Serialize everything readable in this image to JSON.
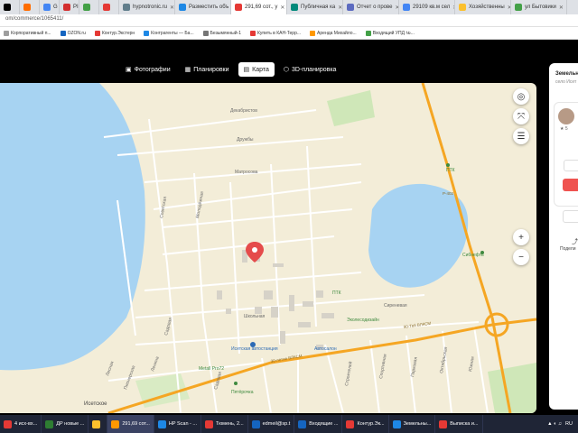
{
  "browser": {
    "tabs": [
      {
        "label": "",
        "color": "#000000",
        "active": false
      },
      {
        "label": "",
        "color": "#ff6d00",
        "active": false
      },
      {
        "label": "G",
        "color": "#4285f4",
        "active": false
      },
      {
        "label": "PIC",
        "color": "#d32f2f",
        "active": false
      },
      {
        "label": "",
        "color": "#43a047",
        "active": false
      },
      {
        "label": "",
        "color": "#e53935",
        "active": false
      },
      {
        "label": "hypnotronic.ru",
        "color": "#607d8b",
        "active": false
      },
      {
        "label": "Разместить объ",
        "color": "#1e88e5",
        "active": false
      },
      {
        "label": "291,69 сот., у",
        "color": "#e53935",
        "active": true
      },
      {
        "label": "Публичная ка",
        "color": "#00897b",
        "active": false
      },
      {
        "label": "Отчет о прове",
        "color": "#5c6bc0",
        "active": false
      },
      {
        "label": "29109 кв.м сел",
        "color": "#4285f4",
        "active": false
      },
      {
        "label": "Хозяйственны",
        "color": "#fbc02d",
        "active": false
      },
      {
        "label": "ул Бытовики",
        "color": "#43a047",
        "active": false
      }
    ],
    "url": "om/commerce/1065411/",
    "bookmarks": [
      {
        "label": "Корпоративный п...",
        "color": "#9e9e9e"
      },
      {
        "label": "OZON.ru",
        "color": "#1565c0"
      },
      {
        "label": "Контур.Экстерн",
        "color": "#e53935"
      },
      {
        "label": "Контрагенты — Ба...",
        "color": "#1e88e5"
      },
      {
        "label": "Безымянный-1",
        "color": "#757575"
      },
      {
        "label": "Купить в КАН-Терр...",
        "color": "#e53935"
      },
      {
        "label": "Аренда Михайло...",
        "color": "#ff9800"
      },
      {
        "label": "Входящий УПД №...",
        "color": "#43a047"
      }
    ]
  },
  "view_tabs": [
    {
      "label": "Фотографии",
      "icon": "photo-icon",
      "glyph": "▣",
      "active": false
    },
    {
      "label": "Планировки",
      "icon": "plan-icon",
      "glyph": "▦",
      "active": false
    },
    {
      "label": "Карта",
      "icon": "map-icon",
      "glyph": "▤",
      "active": true
    },
    {
      "label": "3D-планировка",
      "icon": "3d-icon",
      "glyph": "⬡",
      "active": false
    }
  ],
  "map": {
    "controls": {
      "locate": "◎",
      "fullscreen": "⤧",
      "layers": "☰",
      "zoom_in": "+",
      "zoom_out": "−"
    },
    "labels": {
      "dekabrist": "Декабристов",
      "druzhby": "Дружбы",
      "matrosova": "Матросова",
      "sovetskaya": "Советская",
      "molodezhnaya": "Молодёжная",
      "sirenevaya": "Сиреневая",
      "shkolnaya": "Школьная",
      "sadovaya": "Садовая",
      "r402_1": "Р-402",
      "r402_2": "90-Тей ВЛКСМ",
      "r402_3": "30-летие ВЛКСМ",
      "ozeritsy": "Озерияния",
      "ptk1": "ПТК",
      "ptk2": "ПТК",
      "sibneft": "Сибнефть",
      "isetskaya_avto": "Исетская автостанция",
      "avtosalon": "Автосалон",
      "ekoles": "Эколесодизайн",
      "metall": "Metall Pro72",
      "pyaterochka": "Пятёрочка",
      "iset": "Исетское",
      "lenina": "Ленина",
      "pionerskaya": "Пионерская",
      "lesnaya": "Лесная",
      "sportivnaya": "Спортивная",
      "sadovaya2": "Садовая",
      "parkovaya": "Парковая",
      "oktyabrskaya": "Октябрьская",
      "yuzhnaya": "Южная",
      "stroiteley": "Строителей"
    }
  },
  "side_panel": {
    "title": "Земельн",
    "subtitle": "село Исет",
    "rating": "★ 5",
    "share_icon": "share-icon",
    "share_label": "Подели"
  },
  "taskbar": {
    "items": [
      {
        "label": "4 исх-вх...",
        "color": "#e53935",
        "active": false
      },
      {
        "label": "ДР новые ...",
        "color": "#2e7d32",
        "active": false
      },
      {
        "label": "",
        "color": "#fbc02d",
        "active": false
      },
      {
        "label": "291,69 сот...",
        "color": "#ff9800",
        "active": true
      },
      {
        "label": "HP Scan - ...",
        "color": "#1e88e5",
        "active": false
      },
      {
        "label": "Тюмень, 2...",
        "color": "#e53935",
        "active": false
      },
      {
        "label": "edmeil@sp.t",
        "color": "#1565c0",
        "active": false
      },
      {
        "label": "Входящие ...",
        "color": "#1565c0",
        "active": false
      },
      {
        "label": "Контур.Эк...",
        "color": "#e53935",
        "active": false
      },
      {
        "label": "Земельны...",
        "color": "#1e88e5",
        "active": false
      },
      {
        "label": "Выписка и...",
        "color": "#e53935",
        "active": false
      }
    ],
    "tray": {
      "lang": "RU",
      "time": "",
      "icons": "▲ ◐ ♫"
    }
  }
}
